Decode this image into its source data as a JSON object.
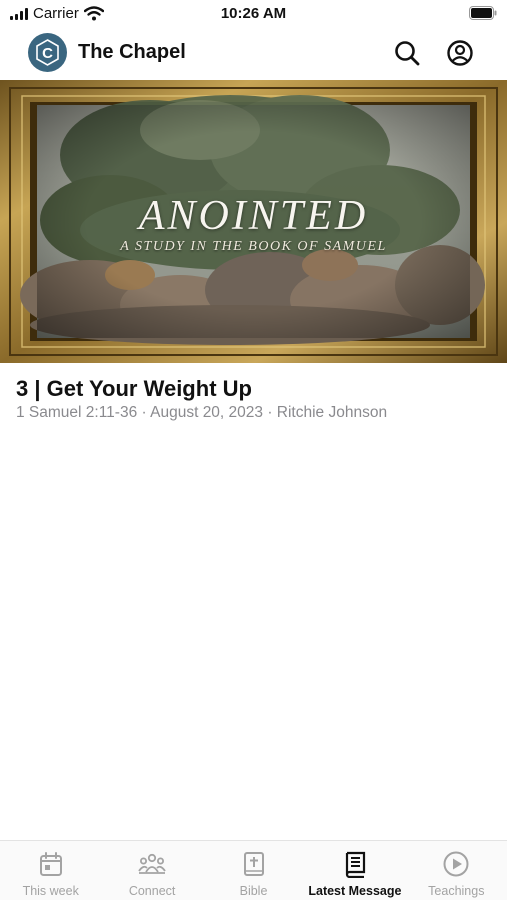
{
  "status_bar": {
    "carrier": "Carrier",
    "time": "10:26 AM"
  },
  "header": {
    "logo_letter": "C",
    "title": "The Chapel",
    "search_icon": "search-icon",
    "profile_icon": "profile-icon"
  },
  "hero": {
    "title": "ANOINTED",
    "subtitle": "A STUDY IN THE BOOK OF SAMUEL"
  },
  "message": {
    "title": "3 | Get Your Weight Up",
    "meta": "1 Samuel 2:11-36 · August 20, 2023 · Ritchie Johnson"
  },
  "tabs": [
    {
      "label": "This week",
      "icon": "calendar-icon",
      "active": false
    },
    {
      "label": "Connect",
      "icon": "people-icon",
      "active": false
    },
    {
      "label": "Bible",
      "icon": "bible-icon",
      "active": false
    },
    {
      "label": "Latest Message",
      "icon": "book-icon",
      "active": true
    },
    {
      "label": "Teachings",
      "icon": "play-icon",
      "active": false
    }
  ],
  "colors": {
    "brand": "#3a6680",
    "active": "#111111",
    "inactive": "#a3a3a3",
    "frame_gold": "#a88434"
  }
}
